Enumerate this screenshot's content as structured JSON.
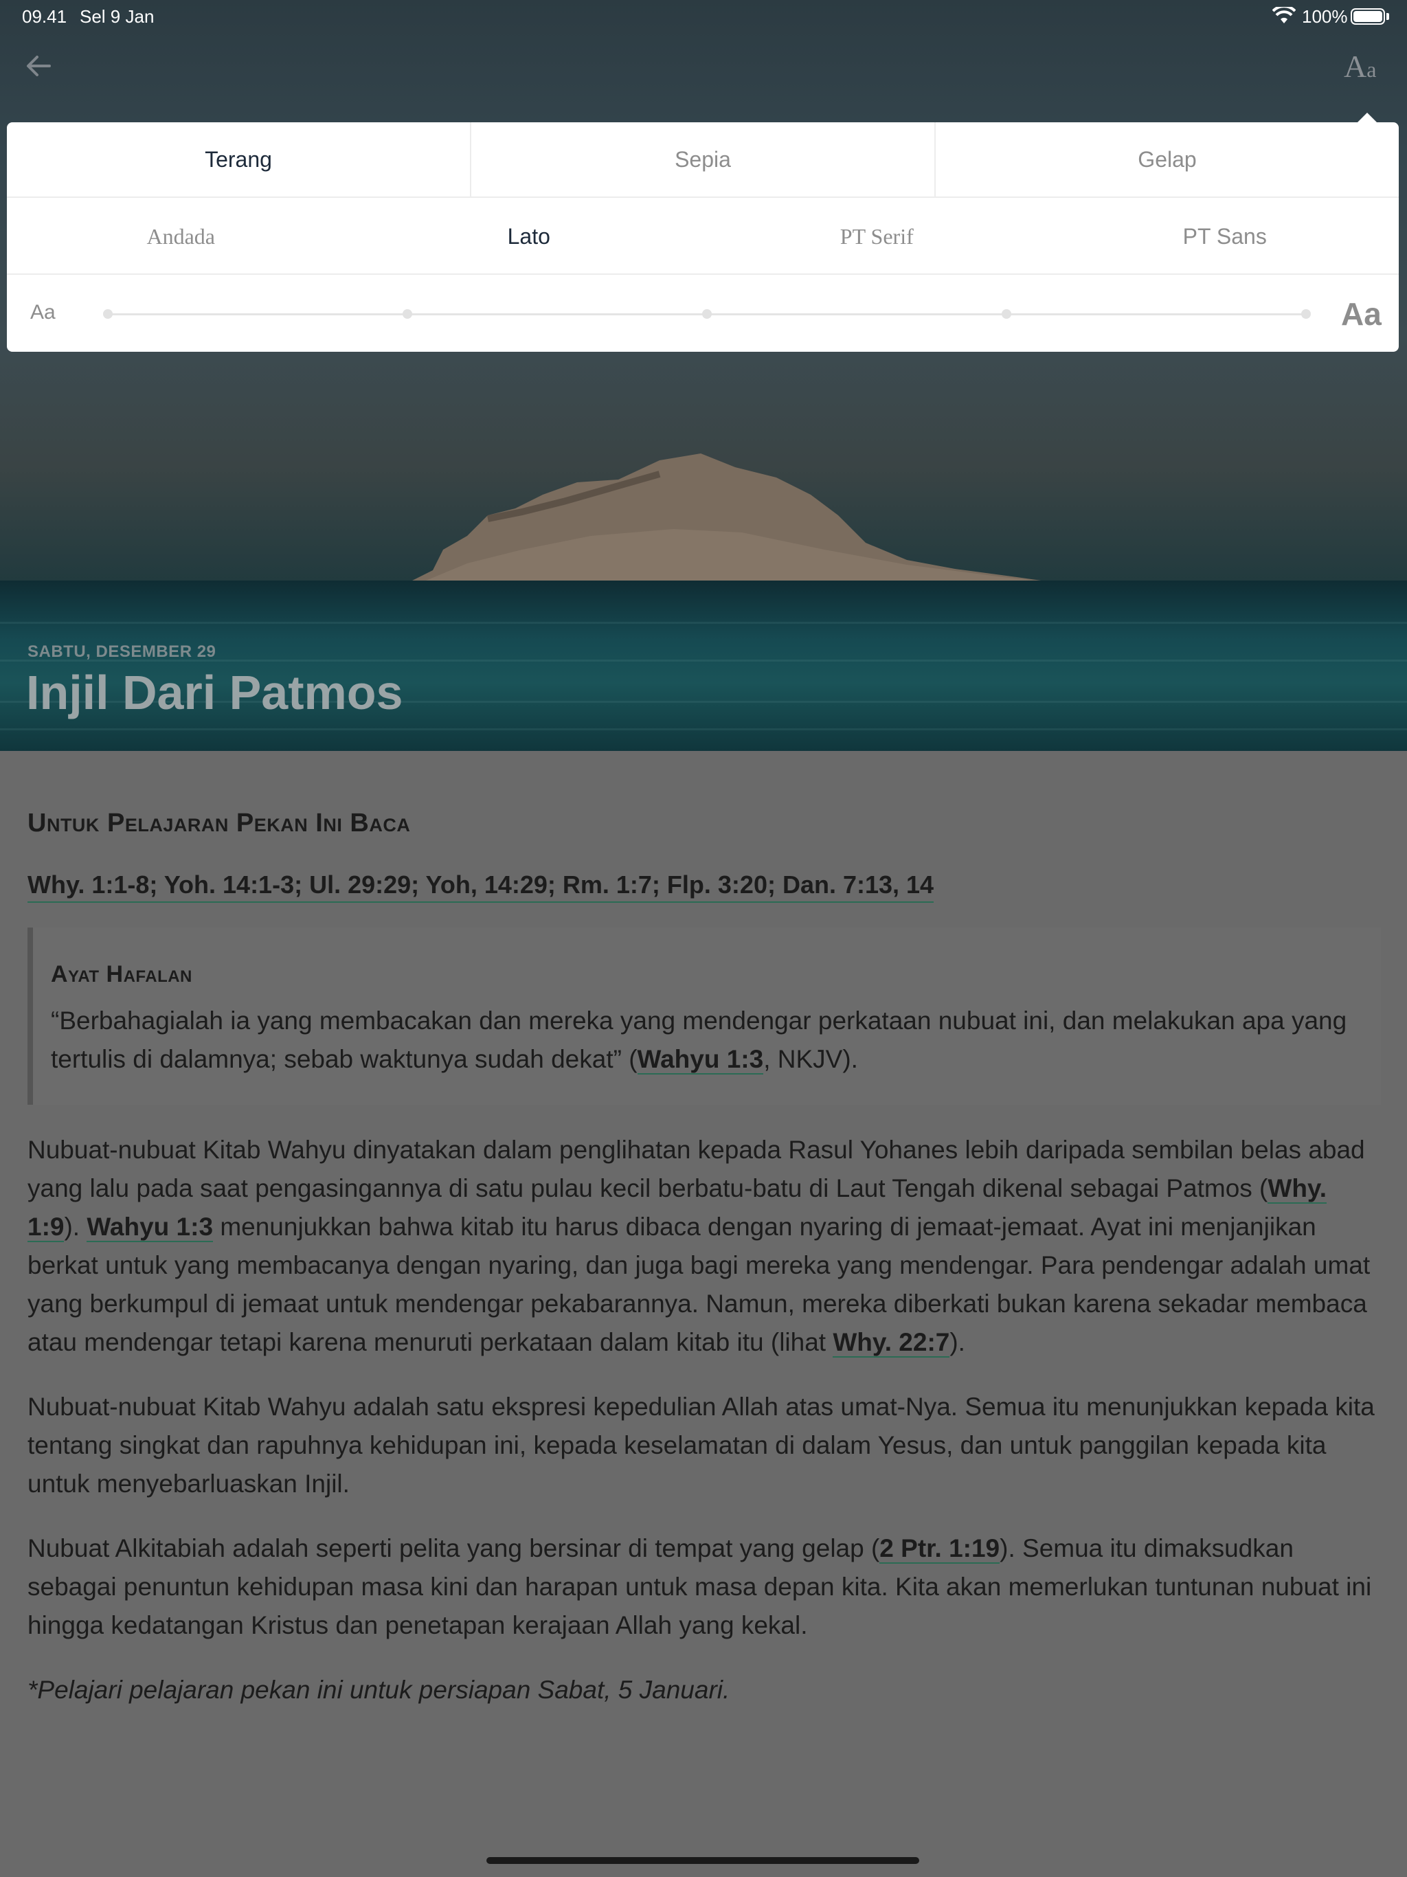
{
  "status_bar": {
    "time": "09.41",
    "date": "Sel 9 Jan",
    "battery": "100%"
  },
  "nav": {
    "font_button_big": "A",
    "font_button_small": "a"
  },
  "reader_settings": {
    "themes": [
      {
        "label": "Terang",
        "active": true
      },
      {
        "label": "Sepia",
        "active": false
      },
      {
        "label": "Gelap",
        "active": false
      }
    ],
    "fonts": [
      {
        "label": "Andada",
        "active": false
      },
      {
        "label": "Lato",
        "active": true
      },
      {
        "label": "PT Serif",
        "active": false
      },
      {
        "label": "PT Sans",
        "active": false
      }
    ],
    "size_small_label": "Aa",
    "size_big_label": "Aa",
    "size_level": 0,
    "size_steps": 5
  },
  "lesson": {
    "day": "SABTU, DESEMBER 29",
    "title": "Injil Dari Patmos"
  },
  "content": {
    "heading": "Untuk Pelajaran Pekan Ini Baca",
    "refs": "Why. 1:1-8; Yoh. 14:1-3; Ul. 29:29; Yoh, 14:29; Rm. 1:7; Flp. 3:20; Dan. 7:13, 14",
    "memory": {
      "title": "Ayat Hafalan",
      "text_before": "“Berbahagialah ia yang membacakan dan mereka yang mendengar perkataan nubuat ini, dan melakukan apa yang tertulis di dalamnya; sebab waktunya sudah dekat” (",
      "link": "Wahyu 1:3",
      "text_after": ", NKJV)."
    },
    "p1": {
      "a": "Nubuat-nubuat Kitab Wahyu dinyatakan dalam penglihatan kepada Rasul Yohanes lebih daripada sembilan belas abad yang lalu pada saat pengasingannya di satu pulau kecil berbatu-batu di Laut Tengah dikenal sebagai Patmos (",
      "link1": "Why. 1:9",
      "b": "). ",
      "link2": "Wahyu 1:3",
      "c": " menunjukkan bahwa kitab itu harus dibaca dengan nyaring di jemaat-jemaat. Ayat ini menjanjikan berkat untuk yang membacanya dengan nyaring, dan juga bagi mereka yang mendengar. Para pendengar adalah umat yang berkumpul di jemaat untuk mendengar pekabarannya. Namun, mereka diberkati bukan karena sekadar membaca atau mendengar tetapi karena menuruti perkataan dalam kitab itu (lihat ",
      "link3": "Why. 22:7",
      "d": ")."
    },
    "p2": "Nubuat-nubuat Kitab Wahyu adalah satu ekspresi kepedulian Allah atas umat-Nya. Semua itu menunjukkan kepada kita tentang singkat dan rapuhnya kehidupan ini, kepada keselamatan di dalam Yesus, dan untuk panggilan kepada kita untuk menyebarluaskan Injil.",
    "p3": {
      "a": "Nubuat Alkitabiah adalah seperti pelita yang bersinar di tempat yang gelap (",
      "link": "2 Ptr. 1:19",
      "b": "). Semua itu dimaksudkan sebagai penuntun kehidupan masa kini dan harapan untuk masa depan kita. Kita akan memerlukan tuntunan nubuat ini hingga kedatangan Kristus dan penetapan kerajaan Allah yang kekal."
    },
    "note": "*Pelajari pelajaran pekan ini untuk persiapan Sabat, 5 Januari."
  }
}
